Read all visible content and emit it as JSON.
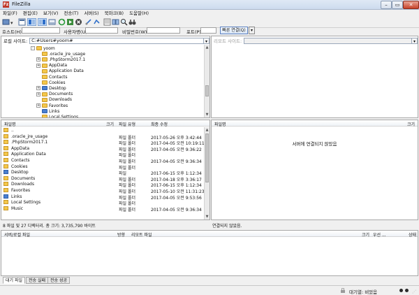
{
  "window": {
    "title": "FileZilla",
    "icon_text": "Fz"
  },
  "menu": [
    "파일(F)",
    "편집(E)",
    "보기(V)",
    "전송(T)",
    "서버(S)",
    "북마크(B)",
    "도움말(H)"
  ],
  "quickconnect": {
    "host_label": "호스트(H):",
    "user_label": "사용자명(U):",
    "pass_label": "비밀번호(W):",
    "port_label": "포트(P):",
    "button_label": "빠른 연결(Q)",
    "dropdown_arrow": "▾"
  },
  "local_site": {
    "label": "로컬 사이트:",
    "path": "C:#Users#yoom#"
  },
  "remote_site": {
    "label": "리모트 사이트:",
    "path": ""
  },
  "tree": [
    {
      "label": "yoom",
      "depth": 1,
      "exp": "-",
      "special": false
    },
    {
      "label": ".oracle_jre_usage",
      "depth": 2,
      "exp": "",
      "special": false
    },
    {
      "label": ".PhpStorm2017.1",
      "depth": 2,
      "exp": "+",
      "special": false
    },
    {
      "label": "AppData",
      "depth": 2,
      "exp": "+",
      "special": false
    },
    {
      "label": "Application Data",
      "depth": 2,
      "exp": "",
      "special": false
    },
    {
      "label": "Contacts",
      "depth": 2,
      "exp": "",
      "special": false
    },
    {
      "label": "Cookies",
      "depth": 2,
      "exp": "",
      "special": false
    },
    {
      "label": "Desktop",
      "depth": 2,
      "exp": "+",
      "special": true
    },
    {
      "label": "Documents",
      "depth": 2,
      "exp": "+",
      "special": false
    },
    {
      "label": "Downloads",
      "depth": 2,
      "exp": "",
      "special": false
    },
    {
      "label": "Favorites",
      "depth": 2,
      "exp": "+",
      "special": false
    },
    {
      "label": "Links",
      "depth": 2,
      "exp": "",
      "special": true
    },
    {
      "label": "Local Settings",
      "depth": 2,
      "exp": "",
      "special": false
    }
  ],
  "local_list": {
    "columns": {
      "name": "파일명",
      "size": "크기",
      "type": "파일 유형",
      "modified": "최종 수정"
    },
    "rows": [
      {
        "name": "..",
        "size": "",
        "type": "",
        "modified": "",
        "special": false
      },
      {
        "name": ".oracle_jre_usage",
        "size": "",
        "type": "파일 폴더",
        "modified": "2017-05-26 오후 3:42:44",
        "special": false
      },
      {
        "name": ".PhpStorm2017.1",
        "size": "",
        "type": "파일 폴더",
        "modified": "2017-04-05 오전 10:19:11",
        "special": false
      },
      {
        "name": "AppData",
        "size": "",
        "type": "파일 폴더",
        "modified": "2017-04-05 오전 9:36:22",
        "special": false
      },
      {
        "name": "Application Data",
        "size": "",
        "type": "파일 폴더",
        "modified": "",
        "special": false
      },
      {
        "name": "Contacts",
        "size": "",
        "type": "파일 폴더",
        "modified": "2017-04-05 오전 9:36:34",
        "special": false
      },
      {
        "name": "Cookies",
        "size": "",
        "type": "파일 폴더",
        "modified": "",
        "special": false
      },
      {
        "name": "Desktop",
        "size": "",
        "type": "파일",
        "modified": "2017-06-15 오후 1:12:34",
        "special": true
      },
      {
        "name": "Documents",
        "size": "",
        "type": "파일 폴더",
        "modified": "2017-04-18 오후 3:36:17",
        "special": false
      },
      {
        "name": "Downloads",
        "size": "",
        "type": "파일 폴더",
        "modified": "2017-06-15 오후 1:12:34",
        "special": false
      },
      {
        "name": "Favorites",
        "size": "",
        "type": "파일 폴더",
        "modified": "2017-05-10 오전 11:31:23",
        "special": false
      },
      {
        "name": "Links",
        "size": "",
        "type": "파일 폴더",
        "modified": "2017-04-05 오전 9:53:56",
        "special": true
      },
      {
        "name": "Local Settings",
        "size": "",
        "type": "파일 폴더",
        "modified": "",
        "special": false
      },
      {
        "name": "Music",
        "size": "",
        "type": "파일 폴더",
        "modified": "2017-04-05 오전 9:36:34",
        "special": false
      }
    ],
    "status": "8 파일 및 27 디렉터리. 총 크기: 3,735,790 바이트"
  },
  "remote_list": {
    "columns": {
      "name": "파일명",
      "size": "크기"
    },
    "message": "서버에 연결되지 않았음",
    "status": "연결되지 않았음."
  },
  "queue": {
    "columns": {
      "server_file": "서버/로컬 파일",
      "direction": "방향",
      "remote_file": "리모트 파일",
      "size": "크기",
      "priority": "우선 ...",
      "state": "상태"
    }
  },
  "tabs": [
    "대기 파일",
    "전송 실패",
    "전송 성공"
  ],
  "statusbar": {
    "queue": "대기열: 비었음"
  }
}
